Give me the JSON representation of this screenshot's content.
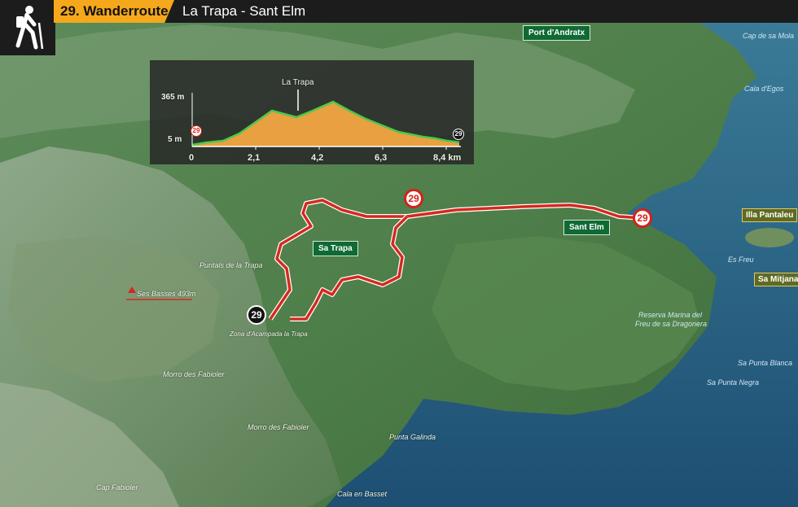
{
  "header": {
    "route_number_label": "29. Wanderroute",
    "route_name": "La Trapa - Sant Elm",
    "icon": "hiker-icon"
  },
  "profile": {
    "peak_label": "La Trapa",
    "elev_max": "365 m",
    "elev_min": "5 m",
    "start_badge": "29",
    "end_badge": "29",
    "x_ticks": [
      "0",
      "2,1",
      "4,2",
      "6,3",
      "8,4 km"
    ],
    "fill_color": "#e8a040",
    "line_color": "#4cc84c"
  },
  "map": {
    "labels_green": {
      "port_andratx": "Port d'Andratx",
      "sa_trapa": "Sa Trapa",
      "sant_elm": "Sant Elm"
    },
    "labels_olive": {
      "illa_pantaleu": "Illa Pantaleu",
      "sa_mitjana": "Sa Mitjana"
    },
    "places": {
      "puntals": "Puntals de la Trapa",
      "ses_basses": "Ses Basses 493m",
      "zona": "Zona d'Acampada la Trapa",
      "morro1": "Morro des Fabioler",
      "morro2": "Morro des Fabioler",
      "cap_fabioler": "Cap Fabioler",
      "punta_galinda": "Punta Galinda",
      "cala_basset": "Cala en Basset"
    },
    "sea": {
      "cap_mola": "Cap de sa Mola",
      "cala_egos": "Cala d'Egos",
      "es_freu": "Es Freu",
      "reserva_1": "Reserva Marina del",
      "reserva_2": "Freu de sa Dragonera",
      "punta_blanca": "Sa Punta Blanca",
      "punta_negra": "Sa Punta Negra"
    },
    "badges": {
      "route_mid": "29",
      "route_end": "29",
      "route_start": "29"
    },
    "route_color": "#d42a1e"
  }
}
